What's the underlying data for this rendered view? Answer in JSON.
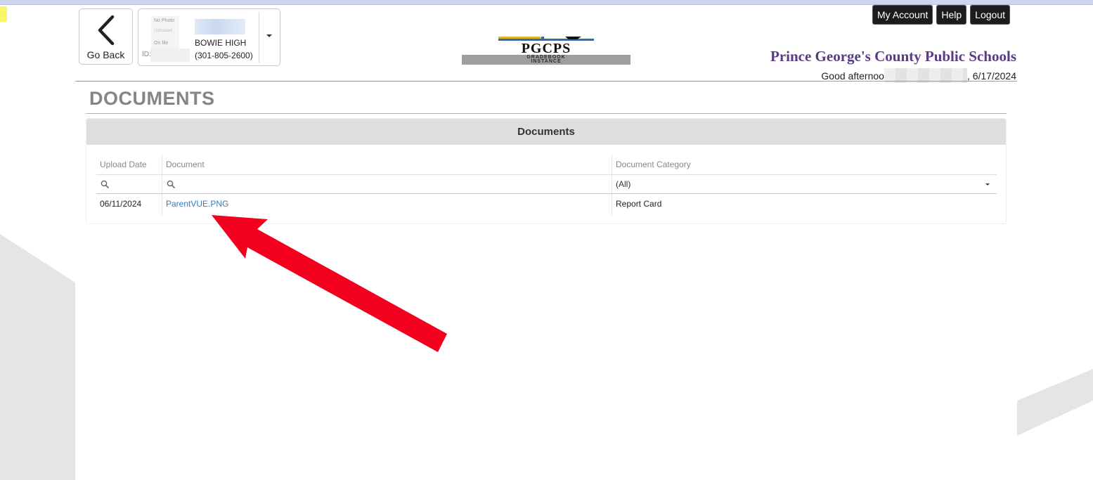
{
  "colors": {
    "district_purple": "#5b3a86",
    "link_blue": "#3d7ab8",
    "annotation_red": "#f2001d",
    "title_gray": "#858585"
  },
  "nav": {
    "go_back_label": "Go Back",
    "go_back_icon": "chevron-left-icon"
  },
  "student": {
    "photo_lines": [
      "No Photo",
      "Uploaded",
      "On file"
    ],
    "id_label": "ID:",
    "school": "BOWIE HIGH",
    "phone": "(301-805-2600)",
    "menu_icon": "caret-down-icon"
  },
  "logo": {
    "wordmark": "PGCPS",
    "line1": "GRADEBOOK",
    "line2": "INSTANCE"
  },
  "header": {
    "buttons": {
      "my_account": "My Account",
      "help": "Help",
      "logout": "Logout"
    },
    "district": "Prince George's County Public Schools",
    "greeting_prefix": "Good afternoo",
    "date": ", 6/17/2024"
  },
  "page": {
    "title": "DOCUMENTS",
    "panel_title": "Documents"
  },
  "grid": {
    "columns": [
      "Upload Date",
      "Document",
      "Document Category"
    ],
    "category_filter_value": "(All)",
    "rows": [
      {
        "upload_date": "06/11/2024",
        "document": "ParentVUE.PNG",
        "category": "Report Card"
      }
    ]
  }
}
